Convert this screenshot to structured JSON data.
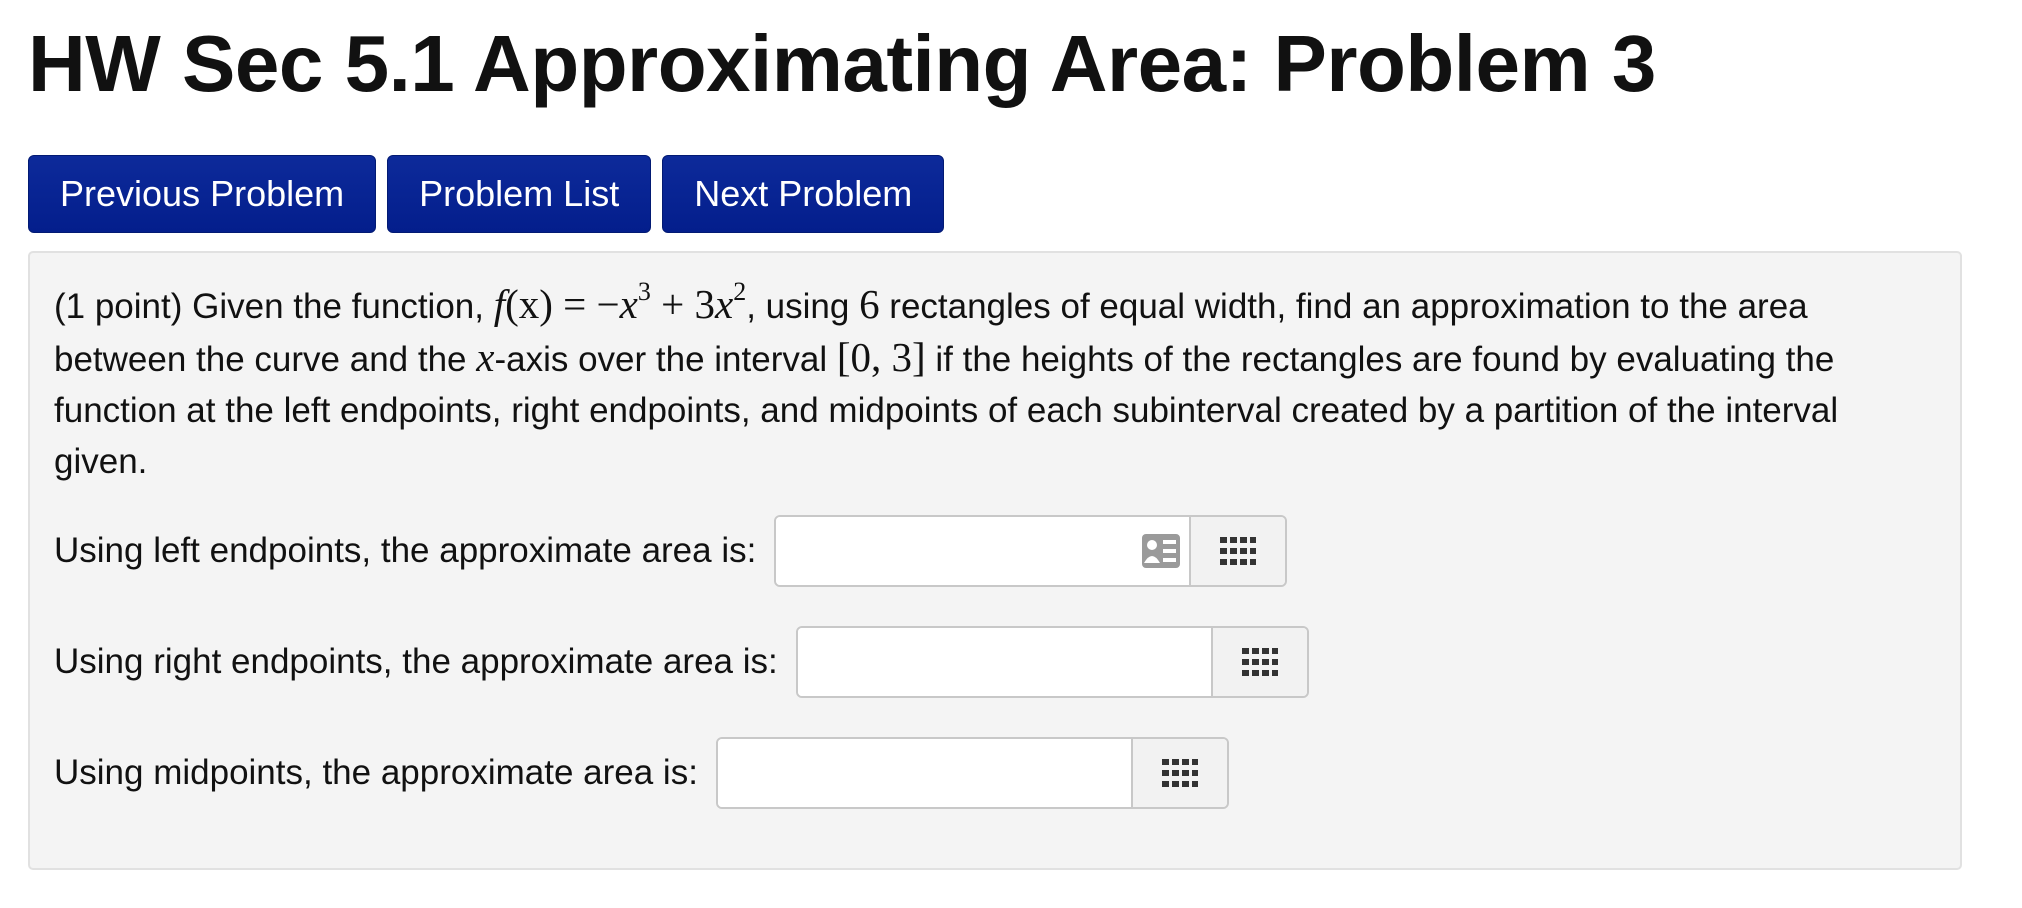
{
  "page": {
    "title": "HW Sec 5.1 Approximating Area: Problem 3"
  },
  "nav": {
    "previous_label": "Previous Problem",
    "list_label": "Problem List",
    "next_label": "Next Problem"
  },
  "problem": {
    "points": "(1 point)",
    "text_1": " Given the function, ",
    "func_name": "f",
    "func_arg": "(x)",
    "equals": " = −",
    "var_x1": "x",
    "exp_1": "3",
    "plus_term": " + 3",
    "var_x2": "x",
    "exp_2": "2",
    "text_2": ", using ",
    "rect_count": "6",
    "text_3": " rectangles of equal width, find an approximation to the area between the curve and the ",
    "axis_var": "x",
    "text_4": "-axis over the interval ",
    "interval": "[0, 3]",
    "text_5": " if the heights of the rectangles are found by evaluating the function at the left endpoints, right endpoints, and midpoints of each subinterval created by a partition of the interval given."
  },
  "answers": [
    {
      "label": "Using left endpoints, the approximate area is:",
      "value": "",
      "has_preview_icon": true
    },
    {
      "label": "Using right endpoints, the approximate area is:",
      "value": "",
      "has_preview_icon": false
    },
    {
      "label": "Using midpoints, the approximate area is:",
      "value": "",
      "has_preview_icon": false
    }
  ],
  "icons": {
    "preview": "contact-card-icon",
    "keypad": "keypad-grid-icon"
  },
  "colors": {
    "button_bg": "#031e8c",
    "panel_bg": "#f4f4f4"
  }
}
